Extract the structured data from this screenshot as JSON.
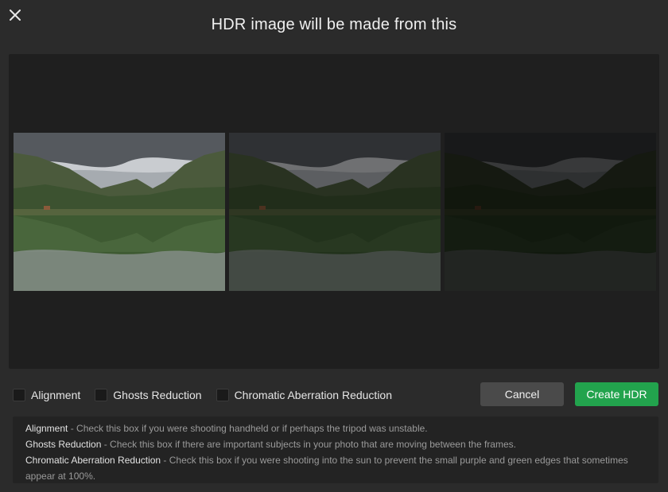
{
  "dialog": {
    "title": "HDR image will be made from this",
    "close_icon": "close-icon"
  },
  "thumbnails": [
    {
      "name": "exposure-normal",
      "brightness": 1.0
    },
    {
      "name": "exposure-under",
      "brightness": 0.55
    },
    {
      "name": "exposure-dark",
      "brightness": 0.28
    }
  ],
  "options": [
    {
      "label": "Alignment",
      "checked": false
    },
    {
      "label": "Ghosts Reduction",
      "checked": false
    },
    {
      "label": "Chromatic Aberration Reduction",
      "checked": false
    }
  ],
  "buttons": {
    "cancel": "Cancel",
    "create": "Create HDR"
  },
  "help": [
    {
      "term": "Alignment",
      "text": " - Check this box if you were shooting handheld or if perhaps the tripod was unstable."
    },
    {
      "term": "Ghosts Reduction",
      "text": " - Check this box if there are important subjects in your photo that are moving between the frames."
    },
    {
      "term": "Chromatic Aberration Reduction",
      "text": " - Check this box if you were shooting into the sun to prevent the small purple and green edges that sometimes appear at 100%."
    }
  ],
  "colors": {
    "accent": "#22a34d",
    "background": "#2b2b2b",
    "panel": "#1f1f1f"
  }
}
